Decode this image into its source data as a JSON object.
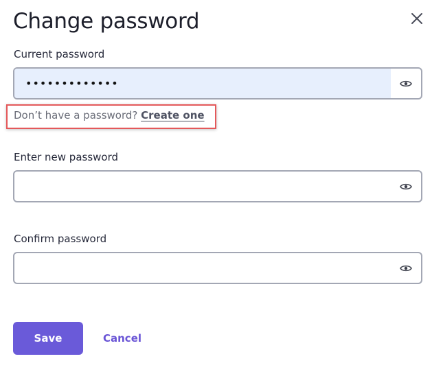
{
  "dialog": {
    "title": "Change password",
    "close_icon": "close-icon"
  },
  "current_password": {
    "label": "Current password",
    "value": "•••••••••••••",
    "placeholder": "",
    "visibility_icon": "eye-icon"
  },
  "helper": {
    "text": "Don’t have a password?",
    "link": "Create one"
  },
  "new_password": {
    "label": "Enter new password",
    "value": "",
    "placeholder": "",
    "visibility_icon": "eye-icon"
  },
  "confirm_password": {
    "label": "Confirm password",
    "value": "",
    "placeholder": "",
    "visibility_icon": "eye-icon"
  },
  "actions": {
    "save_label": "Save",
    "cancel_label": "Cancel"
  },
  "colors": {
    "primary": "#6a5ad9",
    "autofill_bg": "#e7effd",
    "highlight": "#e4585a"
  }
}
